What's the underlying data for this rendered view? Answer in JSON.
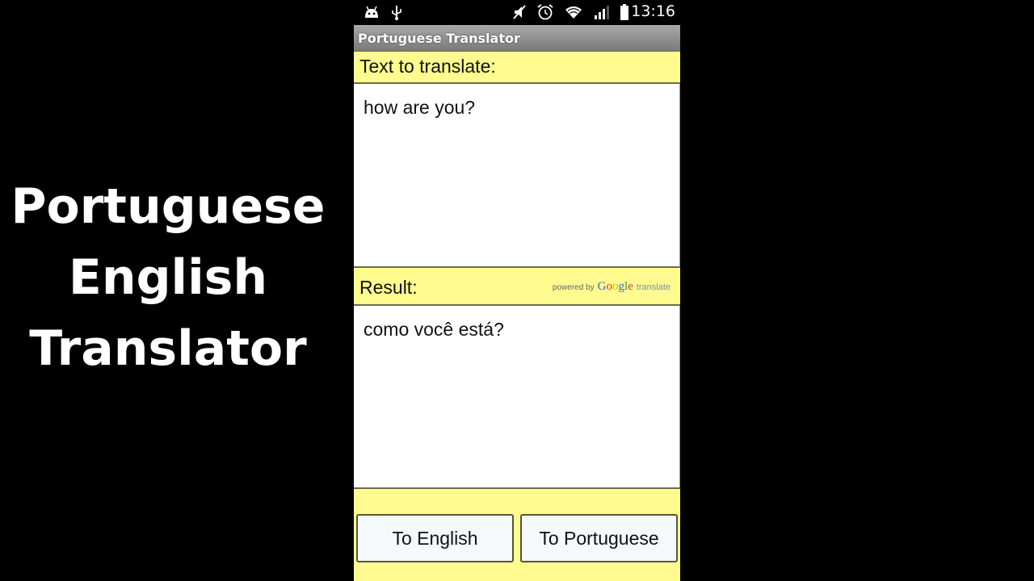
{
  "overlay": {
    "title_lines": [
      "Portuguese",
      "English",
      "Translator"
    ]
  },
  "statusbar": {
    "left_icons": [
      "android-icon",
      "usb-icon"
    ],
    "right_icons": [
      "mute-icon",
      "alarm-icon",
      "wifi-icon",
      "signal-icon",
      "battery-icon"
    ],
    "time": "13:16"
  },
  "app": {
    "title": "Portuguese Translator",
    "input_label": "Text to translate:",
    "input_value": "how are you?",
    "result_label": "Result:",
    "powered_by": {
      "prefix": "powered by",
      "brand": "Google",
      "suffix": "translate"
    },
    "result_value": "como você está?",
    "buttons": {
      "to_english": "To English",
      "to_portuguese": "To Portuguese"
    }
  },
  "colors": {
    "label_background": "#fffb8f",
    "google_letters": [
      "#3b68c9",
      "#d23a2c",
      "#e8b11c",
      "#3b68c9",
      "#2f9a46",
      "#d23a2c"
    ]
  }
}
